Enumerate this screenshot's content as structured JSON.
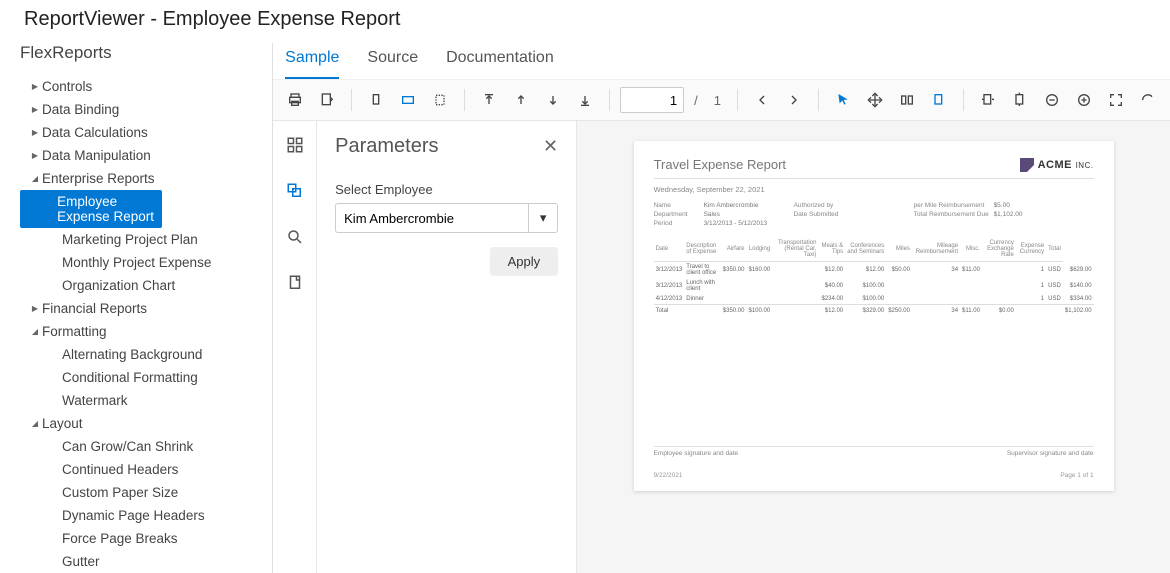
{
  "page_title": "ReportViewer - Employee Expense Report",
  "sidebar": {
    "title": "FlexReports",
    "items": [
      {
        "label": "Controls",
        "caret": "right",
        "indent": 0
      },
      {
        "label": "Data Binding",
        "caret": "right",
        "indent": 0
      },
      {
        "label": "Data Calculations",
        "caret": "right",
        "indent": 0
      },
      {
        "label": "Data Manipulation",
        "caret": "right",
        "indent": 0
      },
      {
        "label": "Enterprise Reports",
        "caret": "down",
        "indent": 0
      },
      {
        "label": "Employee Expense Report",
        "caret": "",
        "indent": 1,
        "selected": true
      },
      {
        "label": "Marketing Project Plan",
        "caret": "",
        "indent": 1
      },
      {
        "label": "Monthly Project Expense",
        "caret": "",
        "indent": 1
      },
      {
        "label": "Organization Chart",
        "caret": "",
        "indent": 1
      },
      {
        "label": "Financial Reports",
        "caret": "right",
        "indent": 0
      },
      {
        "label": "Formatting",
        "caret": "down",
        "indent": 0
      },
      {
        "label": "Alternating Background",
        "caret": "",
        "indent": 1
      },
      {
        "label": "Conditional Formatting",
        "caret": "",
        "indent": 1
      },
      {
        "label": "Watermark",
        "caret": "",
        "indent": 1
      },
      {
        "label": "Layout",
        "caret": "down",
        "indent": 0
      },
      {
        "label": "Can Grow/Can Shrink",
        "caret": "",
        "indent": 1
      },
      {
        "label": "Continued Headers",
        "caret": "",
        "indent": 1
      },
      {
        "label": "Custom Paper Size",
        "caret": "",
        "indent": 1
      },
      {
        "label": "Dynamic Page Headers",
        "caret": "",
        "indent": 1
      },
      {
        "label": "Force Page Breaks",
        "caret": "",
        "indent": 1
      },
      {
        "label": "Gutter",
        "caret": "",
        "indent": 1
      }
    ]
  },
  "tabs": {
    "items": [
      "Sample",
      "Source",
      "Documentation"
    ],
    "active": 0
  },
  "toolbar": {
    "page_current": "1",
    "page_sep": "/",
    "page_total": "1"
  },
  "parameters": {
    "title": "Parameters",
    "field_label": "Select Employee",
    "field_value": "Kim Ambercrombie",
    "apply_label": "Apply"
  },
  "report": {
    "title": "Travel Expense Report",
    "company": "ACME",
    "company_suffix": "INC.",
    "date": "Wednesday, September 22, 2021",
    "meta": {
      "name_lbl": "Name",
      "name": "Kim Ambercrombie",
      "dept_lbl": "Department",
      "dept": "Sales",
      "period_lbl": "Period",
      "period": "3/12/2013 - 5/12/2013",
      "auth_lbl": "Authorized by",
      "auth": "",
      "datesub_lbl": "Date Submitted",
      "datesub": "",
      "permile_lbl": "per Mile Reimbursement",
      "permile": "$5.00",
      "totaldue_lbl": "Total Reimbursement Due",
      "totaldue": "$1,102.00"
    },
    "columns": [
      "Date",
      "Description of Expense",
      "Airfare",
      "Lodging",
      "Transportation (Rental Car, Taxi)",
      "Meals & Tips",
      "Conferences and Seminars",
      "Miles",
      "Mileage Reimbursement",
      "Misc.",
      "Currency Exchange Rate",
      "Expense Currency",
      "Total"
    ],
    "rows": [
      {
        "c": [
          "3/12/2013",
          "Travel to client office",
          "$350.00",
          "$160.00",
          "",
          "$12.00",
          "$12.00",
          "$50.00",
          "34",
          "$11.00",
          "",
          "1",
          "USD",
          "$629.00"
        ]
      },
      {
        "c": [
          "3/12/2013",
          "Lunch with client",
          "",
          "",
          "",
          "$40.00",
          "$100.00",
          "",
          "",
          "",
          "",
          "1",
          "USD",
          "$140.00"
        ]
      },
      {
        "c": [
          "4/12/2013",
          "Dinner",
          "",
          "",
          "",
          "$234.00",
          "$100.00",
          "",
          "",
          "",
          "",
          "1",
          "USD",
          "$334.00"
        ]
      }
    ],
    "total_row": [
      "Total",
      "",
      "$350.00",
      "$100.00",
      "",
      "$12.00",
      "$329.00",
      "$250.00",
      "34",
      "$11.00",
      "$0.00",
      "",
      "",
      "$1,102.00"
    ],
    "sig_left": "Employee signature and date",
    "sig_right": "Supervisor signature and date",
    "footer_left": "9/22/2021",
    "footer_right": "Page 1 of 1"
  }
}
